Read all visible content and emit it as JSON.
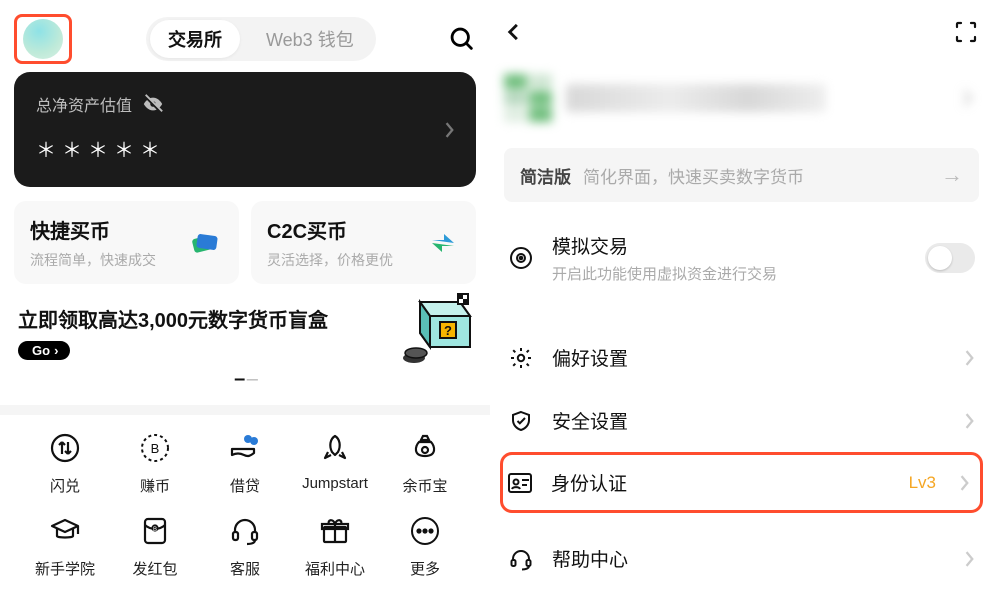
{
  "left": {
    "tabs": {
      "exchange": "交易所",
      "web3": "Web3 钱包"
    },
    "asset": {
      "label": "总净资产估值",
      "masked": "＊＊＊＊＊"
    },
    "buy": {
      "quick": {
        "title": "快捷买币",
        "sub": "流程简单，快速成交"
      },
      "c2c": {
        "title": "C2C买币",
        "sub": "灵活选择，价格更优"
      }
    },
    "banner": {
      "text": "立即领取高达3,000元数字货币盲盒",
      "go": "Go"
    },
    "grid": [
      "闪兑",
      "赚币",
      "借贷",
      "Jumpstart",
      "余币宝",
      "新手学院",
      "发红包",
      "客服",
      "福利中心",
      "更多"
    ]
  },
  "right": {
    "simple": {
      "title": "简洁版",
      "sub": "简化界面，快速买卖数字货币"
    },
    "sim": {
      "title": "模拟交易",
      "sub": "开启此功能使用虚拟资金进行交易"
    },
    "pref": {
      "title": "偏好设置"
    },
    "security": {
      "title": "安全设置"
    },
    "identity": {
      "title": "身份认证",
      "level": "Lv3"
    },
    "help": {
      "title": "帮助中心"
    }
  }
}
